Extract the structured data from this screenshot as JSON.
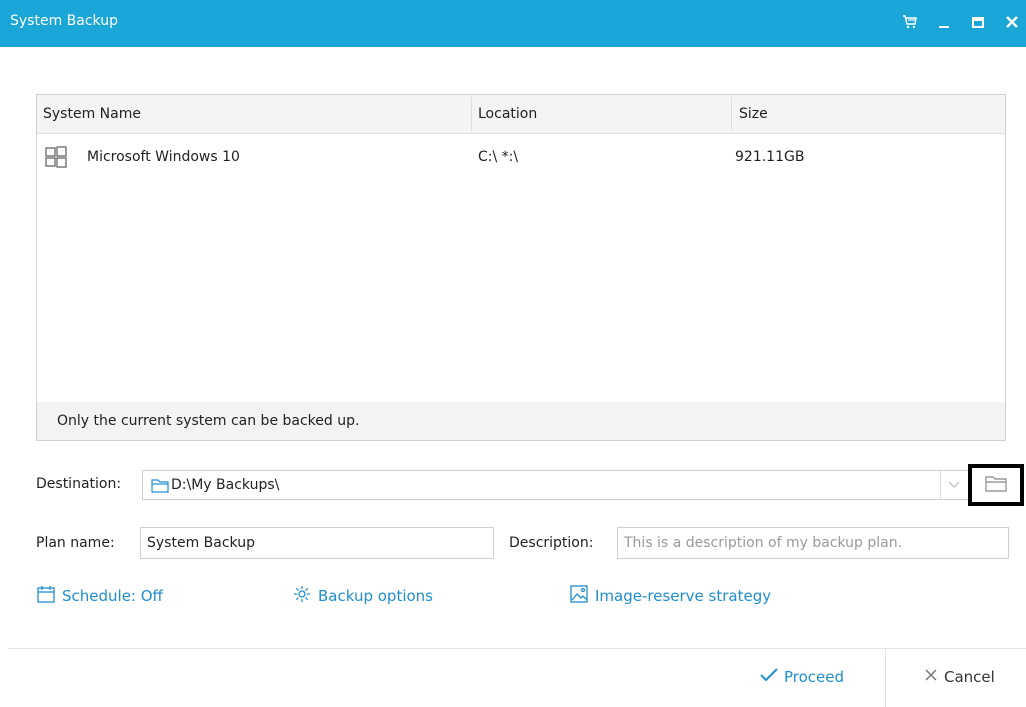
{
  "window": {
    "title": "System Backup",
    "icons": [
      "cart-icon",
      "minimize-icon",
      "maximize-icon",
      "close-icon"
    ],
    "accent_color": "#1ba6d8"
  },
  "system_list": {
    "columns": [
      "System Name",
      "Location",
      "Size"
    ],
    "rows": [
      {
        "icon": "windows-icon",
        "name": "Microsoft Windows 10",
        "location": "C:\\ *:\\",
        "size": "921.11GB"
      }
    ],
    "footer_note": "Only the current system can be backed up."
  },
  "destination": {
    "label": "Destination:",
    "value": "D:\\My Backups\\",
    "folder_icon": "folder-icon",
    "dropdown_icon": "chevron-down-icon",
    "browse_icon": "folder-icon"
  },
  "plan": {
    "name_label": "Plan name:",
    "name_value": "System Backup",
    "description_label": "Description:",
    "description_placeholder": "This is a description of my backup plan."
  },
  "links": {
    "schedule": "Schedule: Off",
    "backup_options": "Backup options",
    "image_reserve": "Image-reserve strategy"
  },
  "actions": {
    "proceed": "Proceed",
    "cancel": "Cancel",
    "link_color": "#1f8ed0"
  }
}
